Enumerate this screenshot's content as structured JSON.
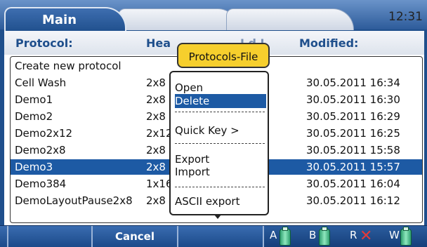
{
  "header": {
    "tab_main_label": "Main",
    "time": "12:31"
  },
  "table": {
    "columns": {
      "protocol": "Protocol:",
      "head": "Hea",
      "hidden": "I d I",
      "modified": "Modified:"
    },
    "rows": [
      {
        "name": "Create new protocol",
        "head": "",
        "modified": "",
        "selected": false
      },
      {
        "name": "Cell Wash",
        "head": "2x8",
        "modified": "30.05.2011 16:34",
        "selected": false
      },
      {
        "name": "Demo1",
        "head": "2x8",
        "modified": "30.05.2011 16:30",
        "selected": false
      },
      {
        "name": "Demo2",
        "head": "2x8",
        "modified": "30.05.2011 16:29",
        "selected": false
      },
      {
        "name": "Demo2x12",
        "head": "2x12",
        "modified": "30.05.2011 16:25",
        "selected": false
      },
      {
        "name": "Demo2x8",
        "head": "2x8",
        "modified": "30.05.2011 15:58",
        "selected": false
      },
      {
        "name": "Demo3",
        "head": "2x8",
        "modified": "30.05.2011 15:57",
        "selected": true
      },
      {
        "name": "Demo384",
        "head": "1x16",
        "modified": "30.05.2011 16:04",
        "selected": false
      },
      {
        "name": "DemoLayoutPause2x8",
        "head": "2x8",
        "modified": "30.05.2011 16:12",
        "selected": false
      }
    ]
  },
  "popup": {
    "title": "Protocols-File",
    "items": [
      "Open",
      "Delete",
      "Quick Key >",
      "Export",
      "Import",
      "ASCII export"
    ],
    "selected_item": "Delete"
  },
  "footer": {
    "cancel_label": "Cancel",
    "status": [
      {
        "label": "A",
        "icon": "bottle-icon"
      },
      {
        "label": "B",
        "icon": "bottle-icon"
      },
      {
        "label": "R",
        "icon": "x-icon"
      },
      {
        "label": "W",
        "icon": "bottle-icon"
      }
    ]
  },
  "colors": {
    "selection": "#1d5aa4",
    "popup_title_bg": "#f6cf2d",
    "column_header_text": "#1f4f8c",
    "bottle": "#2fa070",
    "x_mark": "#e23a3a"
  }
}
